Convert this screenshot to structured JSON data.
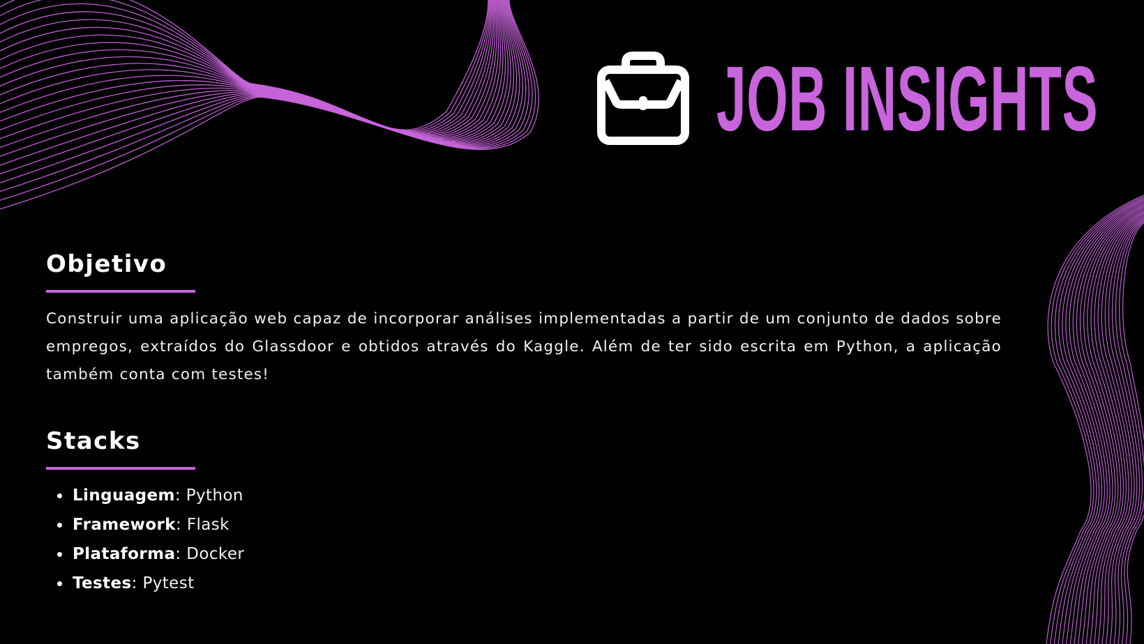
{
  "header": {
    "title": "JOB INSIGHTS",
    "icon": "briefcase-icon"
  },
  "objective": {
    "heading": "Objetivo",
    "text": "Construir uma aplicação web capaz de incorporar análises implementadas a partir de um conjunto de dados sobre empregos, extraídos do Glassdoor e obtidos através do Kaggle. Além de ter sido escrita em Python, a aplicação também conta com testes!"
  },
  "stacks": {
    "heading": "Stacks",
    "items": [
      {
        "key": "Linguagem",
        "sep": ": ",
        "value": "Python"
      },
      {
        "key": "Framework",
        "sep": ": ",
        "value": "Flask"
      },
      {
        "key": "Plataforma",
        "sep": ": ",
        "value": "Docker"
      },
      {
        "key": "Testes",
        "sep": ": ",
        "value": "Pytest"
      }
    ]
  },
  "colors": {
    "background": "#000000",
    "accent": "#c864dc",
    "text": "#ffffff"
  }
}
